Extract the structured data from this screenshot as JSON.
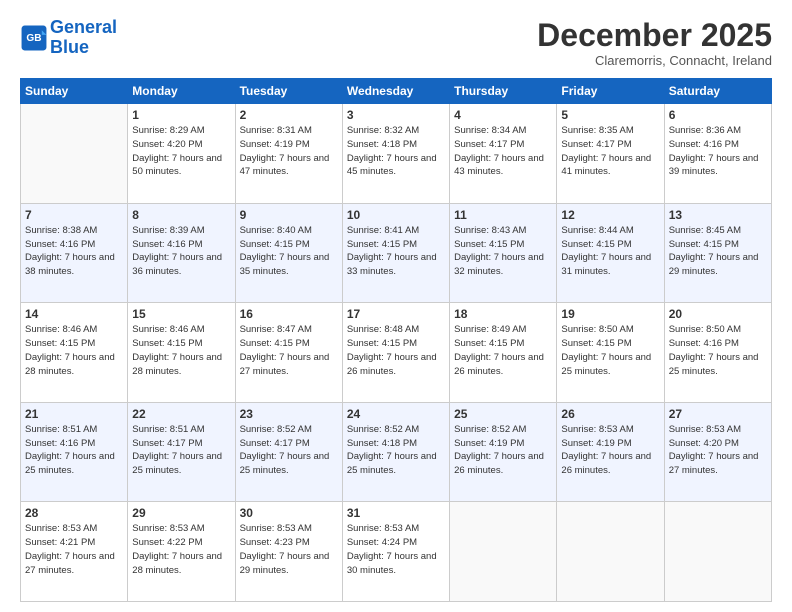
{
  "header": {
    "logo_line1": "General",
    "logo_line2": "Blue",
    "month": "December 2025",
    "location": "Claremorris, Connacht, Ireland"
  },
  "days_of_week": [
    "Sunday",
    "Monday",
    "Tuesday",
    "Wednesday",
    "Thursday",
    "Friday",
    "Saturday"
  ],
  "weeks": [
    [
      {
        "day": "",
        "sunrise": "",
        "sunset": "",
        "daylight": ""
      },
      {
        "day": "1",
        "sunrise": "Sunrise: 8:29 AM",
        "sunset": "Sunset: 4:20 PM",
        "daylight": "Daylight: 7 hours and 50 minutes."
      },
      {
        "day": "2",
        "sunrise": "Sunrise: 8:31 AM",
        "sunset": "Sunset: 4:19 PM",
        "daylight": "Daylight: 7 hours and 47 minutes."
      },
      {
        "day": "3",
        "sunrise": "Sunrise: 8:32 AM",
        "sunset": "Sunset: 4:18 PM",
        "daylight": "Daylight: 7 hours and 45 minutes."
      },
      {
        "day": "4",
        "sunrise": "Sunrise: 8:34 AM",
        "sunset": "Sunset: 4:17 PM",
        "daylight": "Daylight: 7 hours and 43 minutes."
      },
      {
        "day": "5",
        "sunrise": "Sunrise: 8:35 AM",
        "sunset": "Sunset: 4:17 PM",
        "daylight": "Daylight: 7 hours and 41 minutes."
      },
      {
        "day": "6",
        "sunrise": "Sunrise: 8:36 AM",
        "sunset": "Sunset: 4:16 PM",
        "daylight": "Daylight: 7 hours and 39 minutes."
      }
    ],
    [
      {
        "day": "7",
        "sunrise": "Sunrise: 8:38 AM",
        "sunset": "Sunset: 4:16 PM",
        "daylight": "Daylight: 7 hours and 38 minutes."
      },
      {
        "day": "8",
        "sunrise": "Sunrise: 8:39 AM",
        "sunset": "Sunset: 4:16 PM",
        "daylight": "Daylight: 7 hours and 36 minutes."
      },
      {
        "day": "9",
        "sunrise": "Sunrise: 8:40 AM",
        "sunset": "Sunset: 4:15 PM",
        "daylight": "Daylight: 7 hours and 35 minutes."
      },
      {
        "day": "10",
        "sunrise": "Sunrise: 8:41 AM",
        "sunset": "Sunset: 4:15 PM",
        "daylight": "Daylight: 7 hours and 33 minutes."
      },
      {
        "day": "11",
        "sunrise": "Sunrise: 8:43 AM",
        "sunset": "Sunset: 4:15 PM",
        "daylight": "Daylight: 7 hours and 32 minutes."
      },
      {
        "day": "12",
        "sunrise": "Sunrise: 8:44 AM",
        "sunset": "Sunset: 4:15 PM",
        "daylight": "Daylight: 7 hours and 31 minutes."
      },
      {
        "day": "13",
        "sunrise": "Sunrise: 8:45 AM",
        "sunset": "Sunset: 4:15 PM",
        "daylight": "Daylight: 7 hours and 29 minutes."
      }
    ],
    [
      {
        "day": "14",
        "sunrise": "Sunrise: 8:46 AM",
        "sunset": "Sunset: 4:15 PM",
        "daylight": "Daylight: 7 hours and 28 minutes."
      },
      {
        "day": "15",
        "sunrise": "Sunrise: 8:46 AM",
        "sunset": "Sunset: 4:15 PM",
        "daylight": "Daylight: 7 hours and 28 minutes."
      },
      {
        "day": "16",
        "sunrise": "Sunrise: 8:47 AM",
        "sunset": "Sunset: 4:15 PM",
        "daylight": "Daylight: 7 hours and 27 minutes."
      },
      {
        "day": "17",
        "sunrise": "Sunrise: 8:48 AM",
        "sunset": "Sunset: 4:15 PM",
        "daylight": "Daylight: 7 hours and 26 minutes."
      },
      {
        "day": "18",
        "sunrise": "Sunrise: 8:49 AM",
        "sunset": "Sunset: 4:15 PM",
        "daylight": "Daylight: 7 hours and 26 minutes."
      },
      {
        "day": "19",
        "sunrise": "Sunrise: 8:50 AM",
        "sunset": "Sunset: 4:15 PM",
        "daylight": "Daylight: 7 hours and 25 minutes."
      },
      {
        "day": "20",
        "sunrise": "Sunrise: 8:50 AM",
        "sunset": "Sunset: 4:16 PM",
        "daylight": "Daylight: 7 hours and 25 minutes."
      }
    ],
    [
      {
        "day": "21",
        "sunrise": "Sunrise: 8:51 AM",
        "sunset": "Sunset: 4:16 PM",
        "daylight": "Daylight: 7 hours and 25 minutes."
      },
      {
        "day": "22",
        "sunrise": "Sunrise: 8:51 AM",
        "sunset": "Sunset: 4:17 PM",
        "daylight": "Daylight: 7 hours and 25 minutes."
      },
      {
        "day": "23",
        "sunrise": "Sunrise: 8:52 AM",
        "sunset": "Sunset: 4:17 PM",
        "daylight": "Daylight: 7 hours and 25 minutes."
      },
      {
        "day": "24",
        "sunrise": "Sunrise: 8:52 AM",
        "sunset": "Sunset: 4:18 PM",
        "daylight": "Daylight: 7 hours and 25 minutes."
      },
      {
        "day": "25",
        "sunrise": "Sunrise: 8:52 AM",
        "sunset": "Sunset: 4:19 PM",
        "daylight": "Daylight: 7 hours and 26 minutes."
      },
      {
        "day": "26",
        "sunrise": "Sunrise: 8:53 AM",
        "sunset": "Sunset: 4:19 PM",
        "daylight": "Daylight: 7 hours and 26 minutes."
      },
      {
        "day": "27",
        "sunrise": "Sunrise: 8:53 AM",
        "sunset": "Sunset: 4:20 PM",
        "daylight": "Daylight: 7 hours and 27 minutes."
      }
    ],
    [
      {
        "day": "28",
        "sunrise": "Sunrise: 8:53 AM",
        "sunset": "Sunset: 4:21 PM",
        "daylight": "Daylight: 7 hours and 27 minutes."
      },
      {
        "day": "29",
        "sunrise": "Sunrise: 8:53 AM",
        "sunset": "Sunset: 4:22 PM",
        "daylight": "Daylight: 7 hours and 28 minutes."
      },
      {
        "day": "30",
        "sunrise": "Sunrise: 8:53 AM",
        "sunset": "Sunset: 4:23 PM",
        "daylight": "Daylight: 7 hours and 29 minutes."
      },
      {
        "day": "31",
        "sunrise": "Sunrise: 8:53 AM",
        "sunset": "Sunset: 4:24 PM",
        "daylight": "Daylight: 7 hours and 30 minutes."
      },
      {
        "day": "",
        "sunrise": "",
        "sunset": "",
        "daylight": ""
      },
      {
        "day": "",
        "sunrise": "",
        "sunset": "",
        "daylight": ""
      },
      {
        "day": "",
        "sunrise": "",
        "sunset": "",
        "daylight": ""
      }
    ]
  ]
}
